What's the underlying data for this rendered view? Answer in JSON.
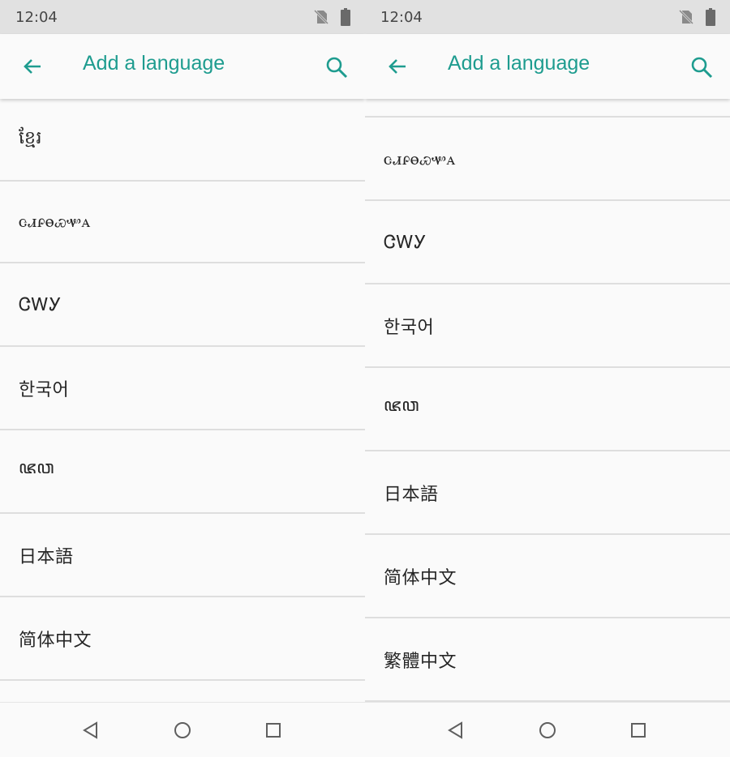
{
  "status_bar": {
    "time": "12:04"
  },
  "app_bar": {
    "title": "Add a language"
  },
  "screens": [
    {
      "languages": [
        "ខ្មែរ",
        "ꮳꮧꮅꮎꮿꮙꭺ",
        "ᏣᎳᎩ",
        "한국어",
        "ꦗꦮ",
        "日本語",
        "简体中文"
      ]
    },
    {
      "languages": [
        "ꮳꮧꮅꮎꮿꮙꭺ",
        "ᏣᎳᎩ",
        "한국어",
        "ꦗꦮ",
        "日本語",
        "简体中文",
        "繁體中文"
      ]
    }
  ],
  "colors": {
    "accent": "#1e9c8f",
    "status_bar_bg": "#e1e1e1",
    "background": "#fafafa",
    "divider": "#dedede"
  },
  "icons": {
    "back": "arrow-left-icon",
    "search": "search-icon",
    "nav_back": "triangle-back-icon",
    "nav_home": "circle-home-icon",
    "nav_recents": "square-recents-icon"
  }
}
